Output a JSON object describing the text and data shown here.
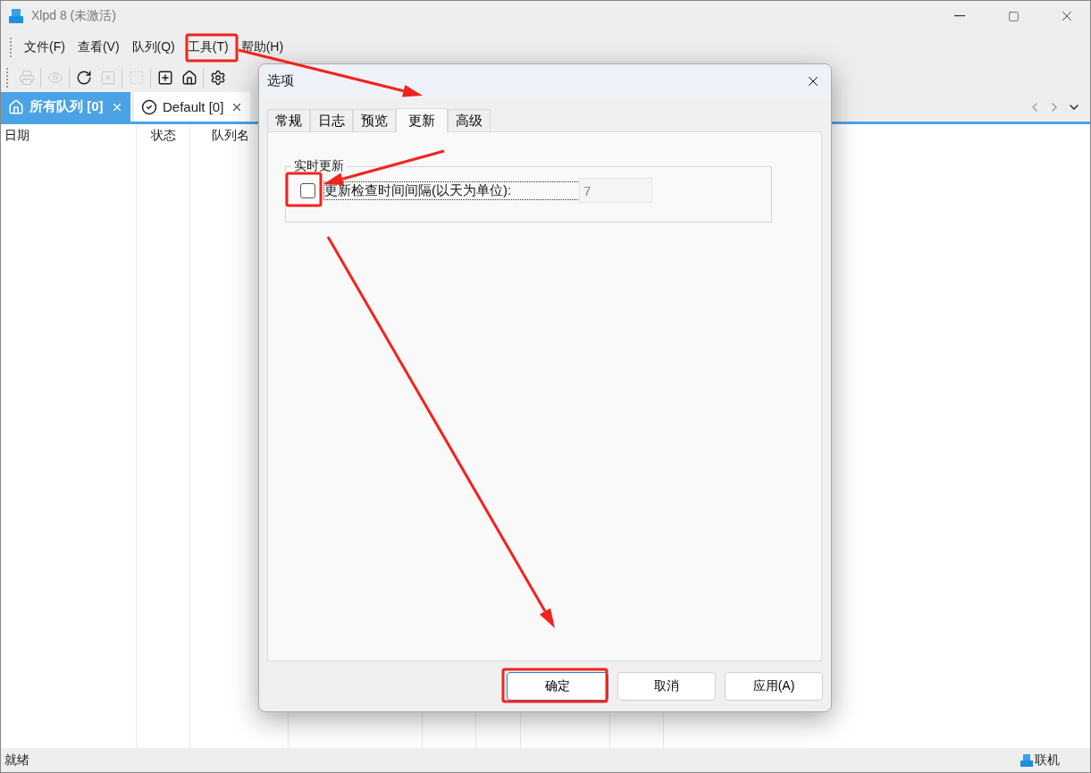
{
  "window": {
    "title": "Xlpd 8 (未激活)"
  },
  "menu": [
    {
      "label": "文件(F)"
    },
    {
      "label": "查看(V)"
    },
    {
      "label": "队列(Q)"
    },
    {
      "label": "工具(T)"
    },
    {
      "label": "帮助(H)"
    }
  ],
  "toolbar": [
    {
      "kind": "print",
      "disabled": true
    },
    {
      "kind": "sep"
    },
    {
      "kind": "view",
      "disabled": true
    },
    {
      "kind": "sep"
    },
    {
      "kind": "refresh",
      "disabled": false
    },
    {
      "kind": "remove",
      "disabled": true
    },
    {
      "kind": "sep"
    },
    {
      "kind": "configure",
      "disabled": true
    },
    {
      "kind": "sep"
    },
    {
      "kind": "add",
      "disabled": false
    },
    {
      "kind": "home",
      "disabled": false
    },
    {
      "kind": "sep"
    },
    {
      "kind": "settings",
      "disabled": false
    }
  ],
  "queue_tabs": [
    {
      "kind": "home",
      "label": "所有队列 [0]",
      "selected": true
    },
    {
      "kind": "check",
      "label": "Default [0]",
      "selected": false
    }
  ],
  "table": {
    "columns": [
      "日期",
      "状态",
      "队列名"
    ]
  },
  "status_bar": {
    "left": "就绪",
    "right": "联机"
  },
  "dialog": {
    "title": "选项",
    "tabs": [
      {
        "label": "常规",
        "selected": false
      },
      {
        "label": "日志",
        "selected": false
      },
      {
        "label": "预览",
        "selected": false
      },
      {
        "label": "更新",
        "selected": true
      },
      {
        "label": "高级",
        "selected": false
      }
    ],
    "group": {
      "legend": "实时更新",
      "checkbox": {
        "label": "更新检查时间间隔(以天为单位):",
        "checked": false
      },
      "interval": {
        "value": "7",
        "disabled": true
      }
    },
    "buttons": [
      {
        "label": "确定",
        "default": true
      },
      {
        "label": "取消",
        "default": false
      },
      {
        "label": "应用(A)",
        "default": false
      }
    ]
  }
}
